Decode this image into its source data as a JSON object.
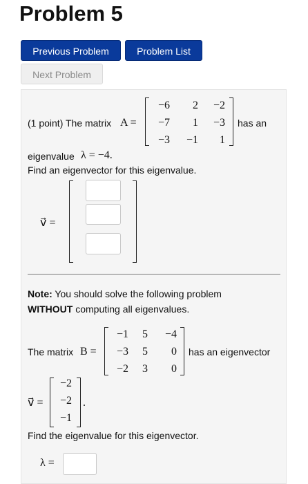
{
  "page_title": "Problem 5",
  "buttons": {
    "previous": "Previous Problem",
    "list": "Problem List",
    "next": "Next Problem"
  },
  "part1": {
    "prefix": "(1 point) The matrix",
    "matrix_name": "A =",
    "matrix": [
      [
        "−6",
        "2",
        "−2"
      ],
      [
        "−7",
        "1",
        "−3"
      ],
      [
        "−3",
        "−1",
        "1"
      ]
    ],
    "suffix": "has an",
    "eigen_label": "eigenvalue",
    "eigen_value": "λ = −4.",
    "instruction": "Find an eigenvector for this eigenvalue.",
    "vector_label": "v⃗ ="
  },
  "part2": {
    "note_label": "Note:",
    "note_text": "You should solve the following problem",
    "note_bold": "WITHOUT",
    "note_rest": "computing all eigenvalues.",
    "prefix": "The matrix",
    "matrix_name": "B =",
    "matrix": [
      [
        "−1",
        "5",
        "−4"
      ],
      [
        "−3",
        "5",
        "0"
      ],
      [
        "−2",
        "3",
        "0"
      ]
    ],
    "suffix": "has an eigenvector",
    "vector_label": "v⃗ =",
    "vector": [
      "−2",
      "−2",
      "−1"
    ],
    "vector_end": ".",
    "instruction": "Find the eigenvalue for this eigenvector.",
    "lambda_label": "λ ="
  }
}
